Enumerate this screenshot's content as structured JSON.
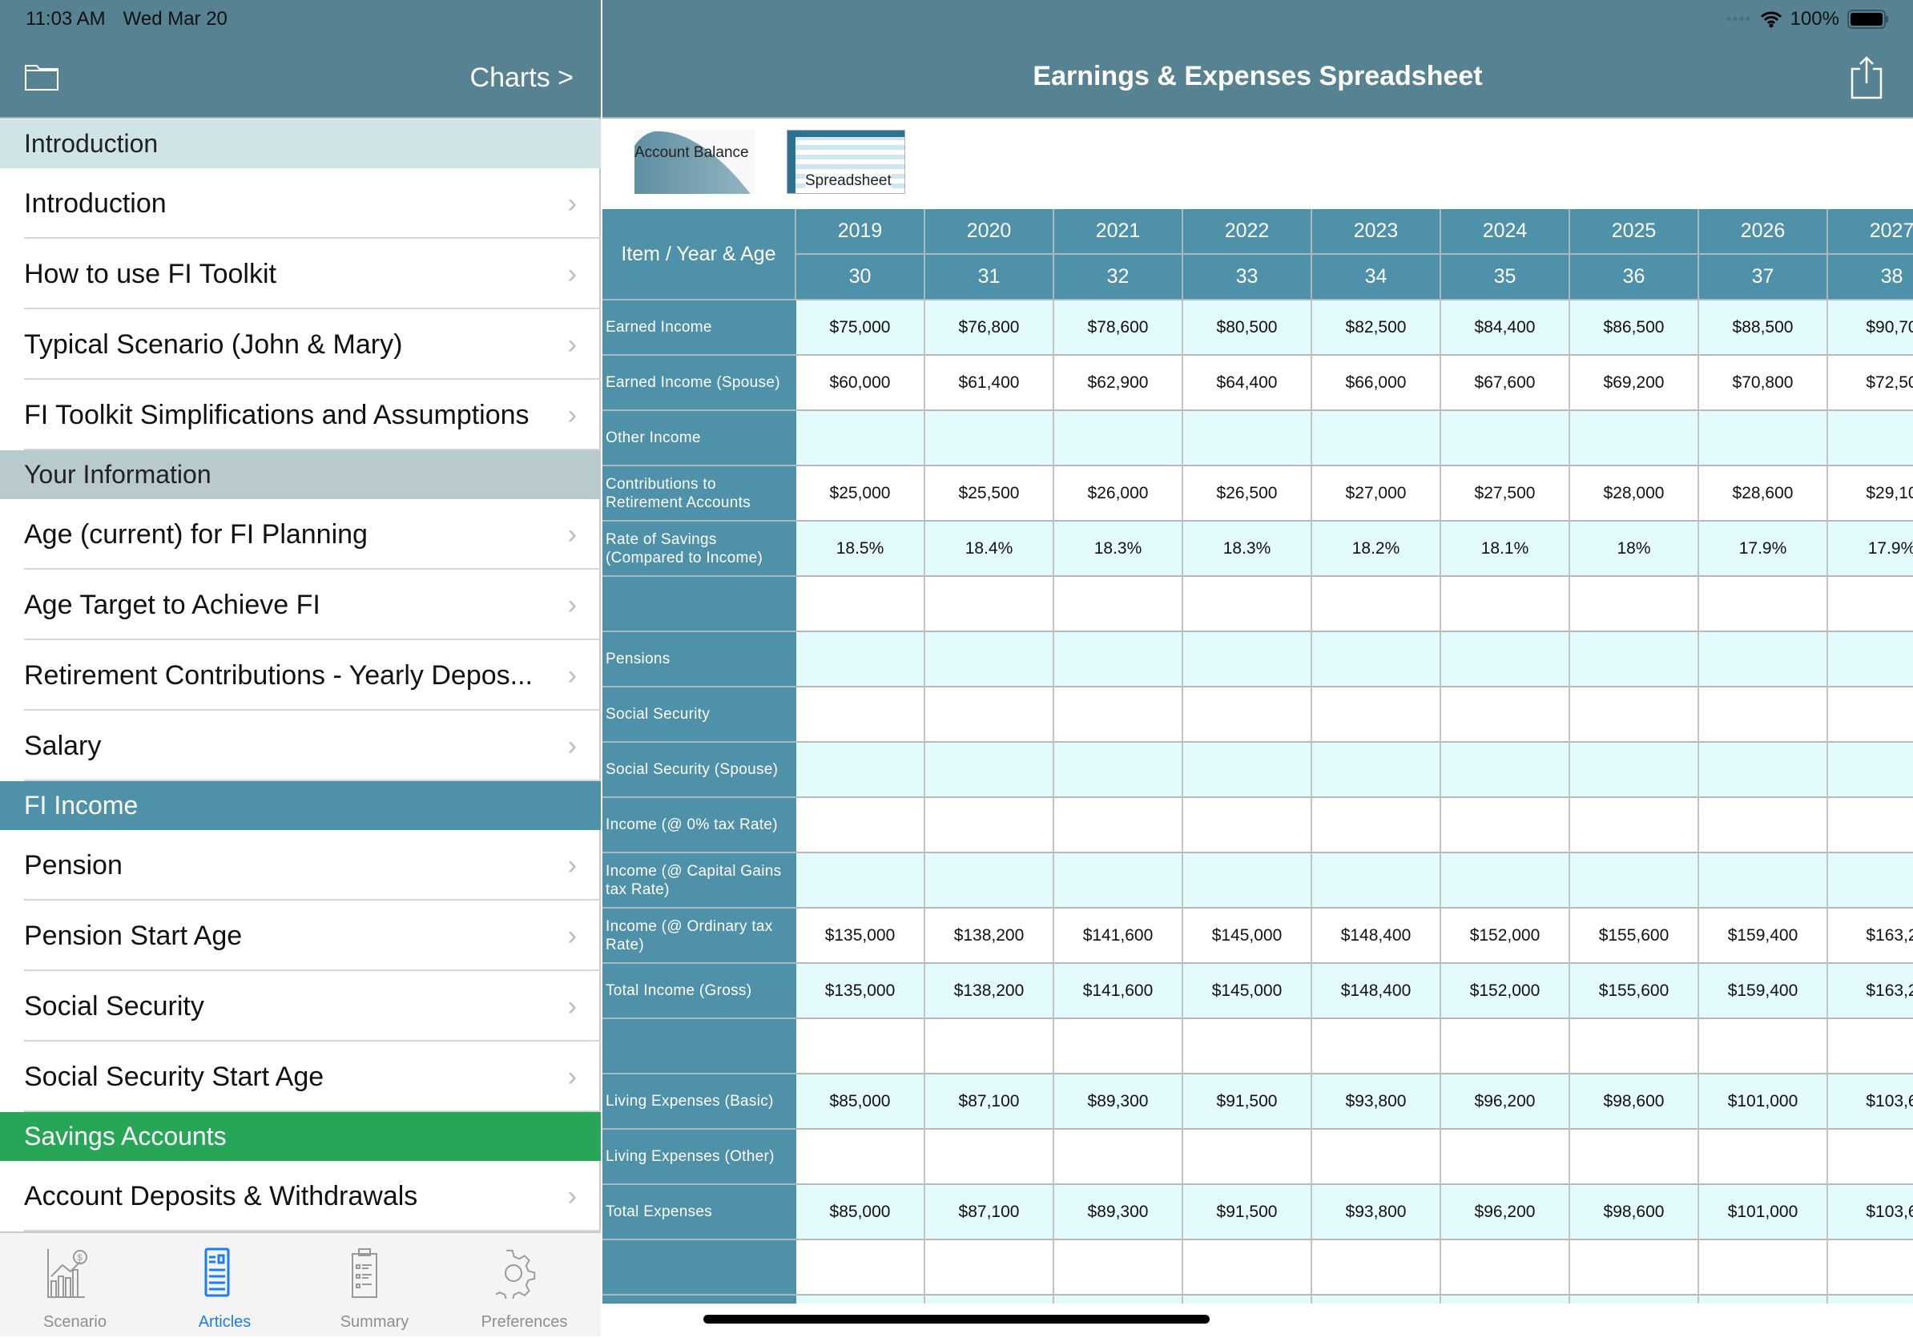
{
  "status": {
    "time": "11:03 AM",
    "date": "Wed Mar 20",
    "battery": "100%"
  },
  "sidebar": {
    "charts_link": "Charts >",
    "sections": [
      {
        "title": "Introduction",
        "color": "#cfe4e7",
        "text_color": "#222222",
        "items": [
          "Introduction",
          "How to use FI Toolkit",
          "Typical Scenario (John & Mary)",
          "FI Toolkit Simplifications and Assumptions"
        ]
      },
      {
        "title": "Your Information",
        "color": "#b8cace",
        "text_color": "#222222",
        "items": [
          "Age (current) for FI Planning",
          "Age Target to Achieve FI",
          "Retirement Contributions - Yearly Depos...",
          "Salary"
        ]
      },
      {
        "title": "FI Income",
        "color": "#4e91a8",
        "text_color": "#ffffff",
        "items": [
          "Pension",
          "Pension Start Age",
          "Social Security",
          "Social Security Start Age"
        ]
      },
      {
        "title": "Savings Accounts",
        "color": "#27a657",
        "text_color": "#ffffff",
        "items": [
          "Account Deposits & Withdrawals"
        ]
      }
    ]
  },
  "tabbar": {
    "tabs": [
      {
        "label": "Scenario",
        "icon": "chart-growth-icon"
      },
      {
        "label": "Articles",
        "icon": "article-icon",
        "active": true
      },
      {
        "label": "Summary",
        "icon": "clipboard-icon"
      },
      {
        "label": "Preferences",
        "icon": "gear-icon"
      }
    ],
    "active_color": "#1a7cf7"
  },
  "main": {
    "title": "Earnings & Expenses Spreadsheet",
    "thumbnails": [
      {
        "label": "Account Balance"
      },
      {
        "label": "Spreadsheet"
      }
    ],
    "table": {
      "corner": "Item / Year & Age",
      "years": [
        "2019",
        "2020",
        "2021",
        "2022",
        "2023",
        "2024",
        "2025",
        "2026",
        "2027"
      ],
      "ages": [
        "30",
        "31",
        "32",
        "33",
        "34",
        "35",
        "36",
        "37",
        "38"
      ],
      "rows": [
        {
          "item": "Earned Income",
          "values": [
            "$75,000",
            "$76,800",
            "$78,600",
            "$80,500",
            "$82,500",
            "$84,400",
            "$86,500",
            "$88,500",
            "$90,70"
          ]
        },
        {
          "item": "Earned Income (Spouse)",
          "values": [
            "$60,000",
            "$61,400",
            "$62,900",
            "$64,400",
            "$66,000",
            "$67,600",
            "$69,200",
            "$70,800",
            "$72,50"
          ]
        },
        {
          "item": "Other Income",
          "values": [
            "",
            "",
            "",
            "",
            "",
            "",
            "",
            "",
            ""
          ]
        },
        {
          "item": "Contributions to Retirement Accounts",
          "values": [
            "$25,000",
            "$25,500",
            "$26,000",
            "$26,500",
            "$27,000",
            "$27,500",
            "$28,000",
            "$28,600",
            "$29,10"
          ]
        },
        {
          "item": "Rate of Savings (Compared to Income)",
          "values": [
            "18.5%",
            "18.4%",
            "18.3%",
            "18.3%",
            "18.2%",
            "18.1%",
            "18%",
            "17.9%",
            "17.9%"
          ]
        },
        {
          "item": "",
          "values": [
            "",
            "",
            "",
            "",
            "",
            "",
            "",
            "",
            ""
          ]
        },
        {
          "item": "Pensions",
          "values": [
            "",
            "",
            "",
            "",
            "",
            "",
            "",
            "",
            ""
          ]
        },
        {
          "item": "Social Security",
          "values": [
            "",
            "",
            "",
            "",
            "",
            "",
            "",
            "",
            ""
          ]
        },
        {
          "item": "Social Security (Spouse)",
          "values": [
            "",
            "",
            "",
            "",
            "",
            "",
            "",
            "",
            ""
          ]
        },
        {
          "item": "Income (@ 0% tax Rate)",
          "values": [
            "",
            "",
            "",
            "",
            "",
            "",
            "",
            "",
            ""
          ]
        },
        {
          "item": "Income (@ Capital Gains tax Rate)",
          "values": [
            "",
            "",
            "",
            "",
            "",
            "",
            "",
            "",
            ""
          ]
        },
        {
          "item": "Income (@ Ordinary tax Rate)",
          "values": [
            "$135,000",
            "$138,200",
            "$141,600",
            "$145,000",
            "$148,400",
            "$152,000",
            "$155,600",
            "$159,400",
            "$163,2"
          ]
        },
        {
          "item": "Total Income (Gross)",
          "values": [
            "$135,000",
            "$138,200",
            "$141,600",
            "$145,000",
            "$148,400",
            "$152,000",
            "$155,600",
            "$159,400",
            "$163,2"
          ]
        },
        {
          "item": "",
          "values": [
            "",
            "",
            "",
            "",
            "",
            "",
            "",
            "",
            ""
          ]
        },
        {
          "item": "Living Expenses (Basic)",
          "values": [
            "$85,000",
            "$87,100",
            "$89,300",
            "$91,500",
            "$93,800",
            "$96,200",
            "$98,600",
            "$101,000",
            "$103,6"
          ]
        },
        {
          "item": "Living Expenses (Other)",
          "values": [
            "",
            "",
            "",
            "",
            "",
            "",
            "",
            "",
            ""
          ]
        },
        {
          "item": "Total Expenses",
          "values": [
            "$85,000",
            "$87,100",
            "$89,300",
            "$91,500",
            "$93,800",
            "$96,200",
            "$98,600",
            "$101,000",
            "$103,6"
          ]
        },
        {
          "item": "",
          "values": [
            "",
            "",
            "",
            "",
            "",
            "",
            "",
            "",
            ""
          ]
        },
        {
          "item": "",
          "values": [
            "",
            "",
            "",
            "",
            "",
            "",
            "",
            "",
            ""
          ]
        }
      ]
    },
    "colors": {
      "header": "#568291",
      "table_header": "#4e91a8",
      "row_alt": "#e3fbfd"
    }
  }
}
